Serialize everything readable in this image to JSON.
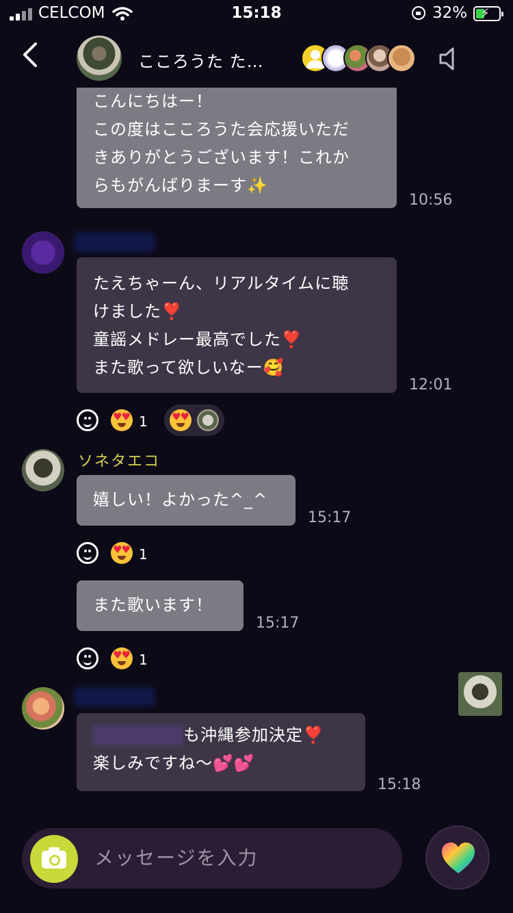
{
  "status_bar": {
    "carrier": "CELCOM",
    "time": "15:18",
    "battery": "32%"
  },
  "header": {
    "title": "こころうた た…",
    "member_avatars": [
      "yellow-person-icon",
      "white-avatar",
      "flowers-avatar",
      "woman-avatar",
      "dog-avatar"
    ]
  },
  "messages": [
    {
      "lines": [
        "こんにちはー！",
        "この度はこころうた会応援いただ",
        "きありがとうございます！これか",
        "らもがんばりまーす✨"
      ],
      "time": "10:56"
    },
    {
      "lines": [
        "たえちゃーん、リアルタイムに聴",
        "けました❣️",
        "童謡メドレー最高でした❣️",
        "また歌って欲しいなー🥰"
      ],
      "time": "12:01",
      "reaction_count": "1"
    },
    {
      "sender": "ソネタエコ",
      "text": "嬉しい！よかった^_^",
      "time": "15:17",
      "reaction_count": "1"
    },
    {
      "text": "また歌います！",
      "time": "15:17",
      "reaction_count": "1"
    },
    {
      "line1_suffix": "も沖縄参加決定❣️",
      "line2": "楽しみですね〜💕💕",
      "time": "15:18"
    }
  ],
  "composer": {
    "placeholder": "メッセージを入力"
  },
  "icons": {
    "back": "chevron-left-icon",
    "speaker": "speaker-mute-icon",
    "smile": "add-reaction-icon",
    "heart_eyes": "heart-eyes-emoji",
    "camera": "camera-icon",
    "heart": "rainbow-heart-icon"
  },
  "colors": {
    "background": "#0d0a18",
    "bubble": "#7c7b84",
    "bubble_dark": "#3e3647",
    "sender_name": "#d6d14c",
    "camera_button": "#c8d93a"
  }
}
